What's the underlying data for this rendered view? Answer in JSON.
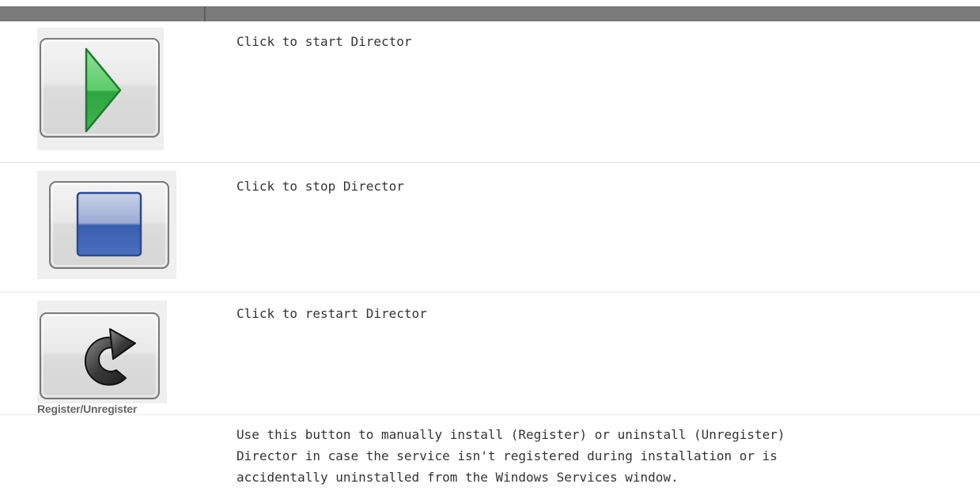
{
  "header": {
    "col1": "",
    "col2": ""
  },
  "rows": [
    {
      "icon": "start-icon",
      "description": "Click to start Director"
    },
    {
      "icon": "stop-icon",
      "description": "Click to stop Director"
    },
    {
      "icon": "restart-icon",
      "description": "Click to restart Director"
    },
    {
      "label": "Register/Unregister",
      "description_lines": [
        "Use this button to manually install (Register) or uninstall (Unregister)",
        "Director in case the service isn't registered during installation or is",
        "accidentally uninstalled from the Windows Services window."
      ]
    }
  ],
  "colors": {
    "header": "#7a7a7a",
    "start_green": "#3cb44a",
    "stop_blue": "#3a63b4"
  }
}
